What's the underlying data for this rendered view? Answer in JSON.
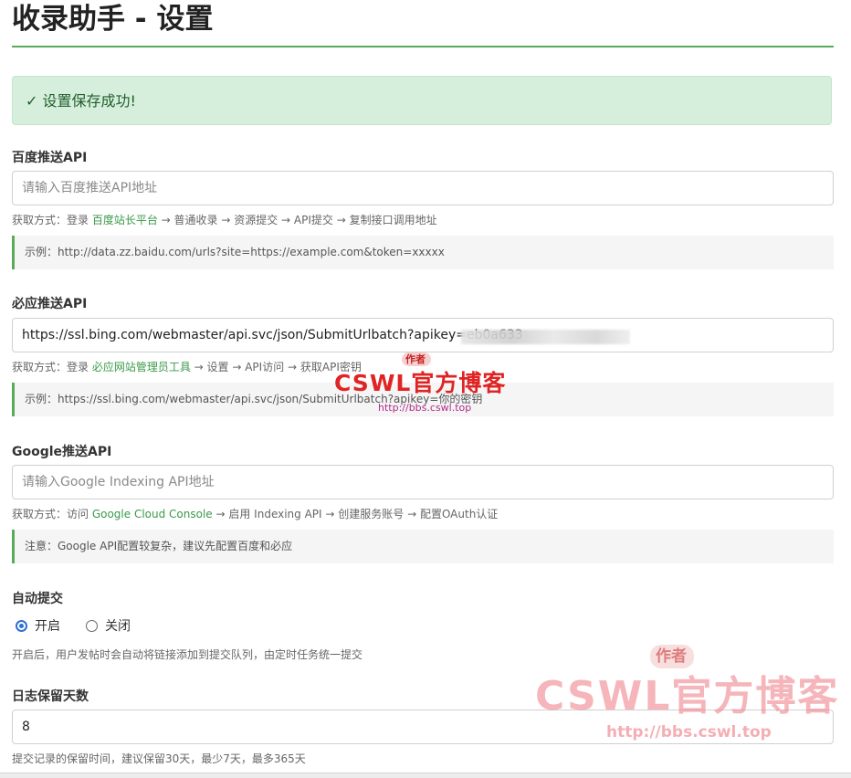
{
  "page": {
    "title": "收录助手 - 设置"
  },
  "alert": {
    "message": "✓ 设置保存成功!"
  },
  "baidu": {
    "label": "百度推送API",
    "placeholder": "请输入百度推送API地址",
    "value": "",
    "help_prefix": "获取方式：登录 ",
    "help_link": "百度站长平台",
    "help_suffix": " → 普通收录 → 资源提交 → API提交 → 复制接口调用地址",
    "example": "示例：http://data.zz.baidu.com/urls?site=https://example.com&token=xxxxx"
  },
  "bing": {
    "label": "必应推送API",
    "placeholder": "",
    "value": "https://ssl.bing.com/webmaster/api.svc/json/SubmitUrlbatch?apikey=eb0a633",
    "help_prefix": "获取方式：登录 ",
    "help_link": "必应网站管理员工具",
    "help_suffix": " → 设置 → API访问 → 获取API密钥",
    "example": "示例：https://ssl.bing.com/webmaster/api.svc/json/SubmitUrlbatch?apikey=你的密钥"
  },
  "google": {
    "label": "Google推送API",
    "placeholder": "请输入Google Indexing API地址",
    "value": "",
    "help_prefix": "获取方式：访问 ",
    "help_link": "Google Cloud Console",
    "help_suffix": " → 启用 Indexing API → 创建服务账号 → 配置OAuth认证",
    "note": "注意：Google API配置较复杂，建议先配置百度和必应"
  },
  "auto_submit": {
    "label": "自动提交",
    "options": [
      "开启",
      "关闭"
    ],
    "selected": "开启",
    "help": "开启后，用户发帖时会自动将链接添加到提交队列，由定时任务统一提交"
  },
  "log_retention": {
    "label": "日志保留天数",
    "value": "8",
    "help": "提交记录的保留时间，建议保留30天，最少7天，最多365天"
  },
  "watermark": {
    "tag": "作者",
    "brand": "CSWL官方博客",
    "url": "http://bbs.cswl.top"
  },
  "colors": {
    "accent": "#5aaa5a",
    "success_bg": "#d6efdc",
    "link": "#3a9a48",
    "radio": "#2f6fd1"
  }
}
